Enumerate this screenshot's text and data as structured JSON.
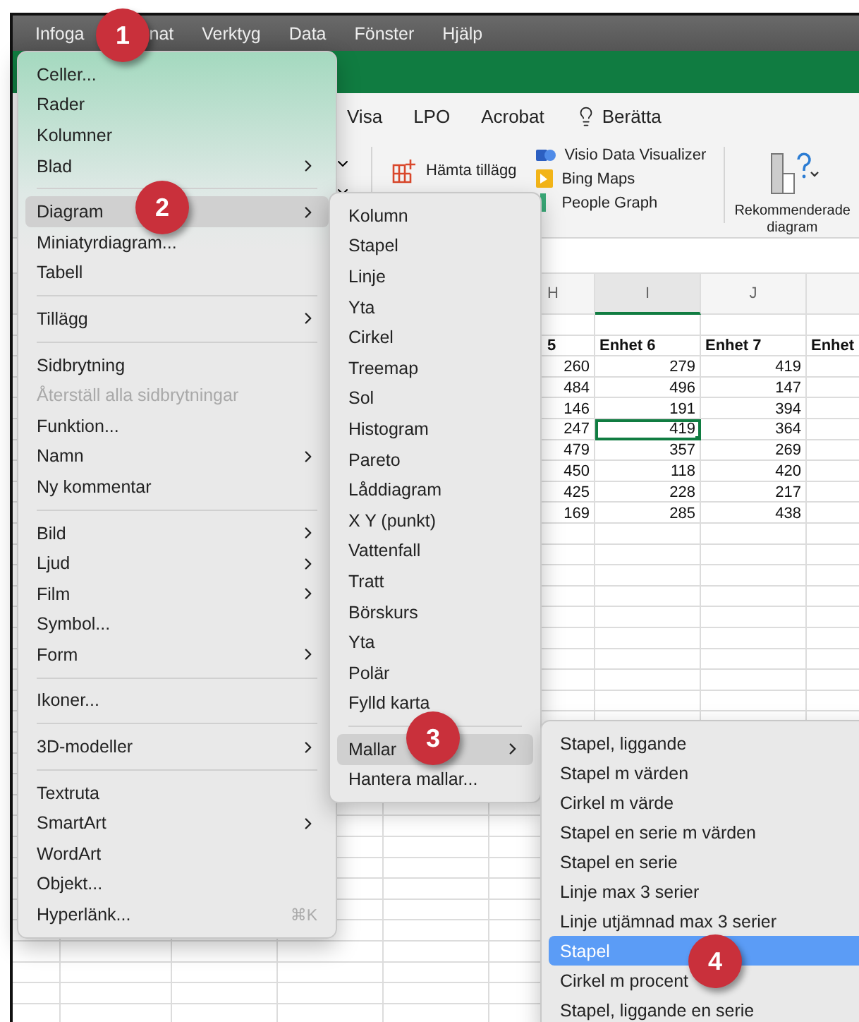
{
  "menu_bar": [
    {
      "label": "Infoga"
    },
    {
      "label": "nat"
    },
    {
      "label": "Verktyg"
    },
    {
      "label": "Data"
    },
    {
      "label": "Fönster"
    },
    {
      "label": "Hjälp"
    }
  ],
  "ribbon": {
    "tabs": [
      "Visa",
      "LPO",
      "Acrobat",
      "Berätta"
    ],
    "addins_button": "Hämta tillägg",
    "addins": [
      {
        "kind": "visio",
        "label": "Visio Data Visualizer"
      },
      {
        "kind": "bing",
        "label": "Bing Maps"
      },
      {
        "kind": "people",
        "label": "People Graph"
      }
    ],
    "recommended": "Rekommenderade diagram"
  },
  "sheet": {
    "column_headers": [
      {
        "label": "H",
        "selected": false
      },
      {
        "label": "I",
        "selected": true
      },
      {
        "label": "J",
        "selected": false
      }
    ],
    "header_row": [
      "5",
      "Enhet 6",
      "Enhet 7",
      "Enhet"
    ],
    "rows": [
      {
        "cells": [
          "260",
          "279",
          "419"
        ],
        "selected": false
      },
      {
        "cells": [
          "484",
          "496",
          "147"
        ],
        "selected": false
      },
      {
        "cells": [
          "146",
          "191",
          "394"
        ],
        "selected": false
      },
      {
        "cells": [
          "247",
          "419",
          "364"
        ],
        "selected": true
      },
      {
        "cells": [
          "479",
          "357",
          "269"
        ],
        "selected": false
      },
      {
        "cells": [
          "450",
          "118",
          "420"
        ],
        "selected": false
      },
      {
        "cells": [
          "425",
          "228",
          "217"
        ],
        "selected": false
      },
      {
        "cells": [
          "169",
          "285",
          "438"
        ],
        "selected": false
      }
    ]
  },
  "insert_menu": [
    {
      "kind": "item",
      "label": "Celler..."
    },
    {
      "kind": "item",
      "label": "Rader"
    },
    {
      "kind": "item",
      "label": "Kolumner"
    },
    {
      "kind": "submenu",
      "label": "Blad"
    },
    {
      "kind": "separator"
    },
    {
      "kind": "submenu",
      "label": "Diagram",
      "selected": true
    },
    {
      "kind": "item",
      "label": "Miniatyrdiagram..."
    },
    {
      "kind": "item",
      "label": "Tabell"
    },
    {
      "kind": "separator"
    },
    {
      "kind": "submenu",
      "label": "Tillägg"
    },
    {
      "kind": "separator"
    },
    {
      "kind": "item",
      "label": "Sidbrytning"
    },
    {
      "kind": "item",
      "label": "Återställ alla sidbrytningar",
      "disabled": true
    },
    {
      "kind": "item",
      "label": "Funktion..."
    },
    {
      "kind": "submenu",
      "label": "Namn"
    },
    {
      "kind": "item",
      "label": "Ny kommentar"
    },
    {
      "kind": "separator"
    },
    {
      "kind": "submenu",
      "label": "Bild"
    },
    {
      "kind": "submenu",
      "label": "Ljud"
    },
    {
      "kind": "submenu",
      "label": "Film"
    },
    {
      "kind": "item",
      "label": "Symbol..."
    },
    {
      "kind": "submenu",
      "label": "Form"
    },
    {
      "kind": "separator"
    },
    {
      "kind": "item",
      "label": "Ikoner..."
    },
    {
      "kind": "separator"
    },
    {
      "kind": "submenu",
      "label": "3D-modeller"
    },
    {
      "kind": "separator"
    },
    {
      "kind": "item",
      "label": "Textruta"
    },
    {
      "kind": "submenu",
      "label": "SmartArt"
    },
    {
      "kind": "item",
      "label": "WordArt"
    },
    {
      "kind": "item",
      "label": "Objekt..."
    },
    {
      "kind": "item",
      "label": "Hyperlänk...",
      "shortcut": "⌘K"
    }
  ],
  "chart_menu": [
    {
      "kind": "item",
      "label": "Kolumn"
    },
    {
      "kind": "item",
      "label": "Stapel"
    },
    {
      "kind": "item",
      "label": "Linje"
    },
    {
      "kind": "item",
      "label": "Yta"
    },
    {
      "kind": "item",
      "label": "Cirkel"
    },
    {
      "kind": "item",
      "label": "Treemap"
    },
    {
      "kind": "item",
      "label": "Sol"
    },
    {
      "kind": "item",
      "label": "Histogram"
    },
    {
      "kind": "item",
      "label": "Pareto"
    },
    {
      "kind": "item",
      "label": "Låddiagram"
    },
    {
      "kind": "item",
      "label": "X Y (punkt)"
    },
    {
      "kind": "item",
      "label": "Vattenfall"
    },
    {
      "kind": "item",
      "label": "Tratt"
    },
    {
      "kind": "item",
      "label": "Börskurs"
    },
    {
      "kind": "item",
      "label": "Yta"
    },
    {
      "kind": "item",
      "label": "Polär"
    },
    {
      "kind": "item",
      "label": "Fylld karta"
    },
    {
      "kind": "separator"
    },
    {
      "kind": "submenu",
      "label": "Mallar",
      "selected": true
    },
    {
      "kind": "item",
      "label": "Hantera mallar..."
    }
  ],
  "templates_menu": [
    {
      "label": "Stapel, liggande",
      "selected": false
    },
    {
      "label": "Stapel m värden",
      "selected": false
    },
    {
      "label": "Cirkel m värde",
      "selected": false
    },
    {
      "label": "Stapel en serie m värden",
      "selected": false
    },
    {
      "label": "Stapel en serie",
      "selected": false
    },
    {
      "label": "Linje max 3 serier",
      "selected": false
    },
    {
      "label": "Linje utjämnad  max 3 serier",
      "selected": false
    },
    {
      "label": "Stapel",
      "selected": true
    },
    {
      "label": "Cirkel m procent",
      "selected": false
    },
    {
      "label": "Stapel, liggande en serie",
      "selected": false
    }
  ],
  "callouts": [
    "1",
    "2",
    "3",
    "4"
  ]
}
